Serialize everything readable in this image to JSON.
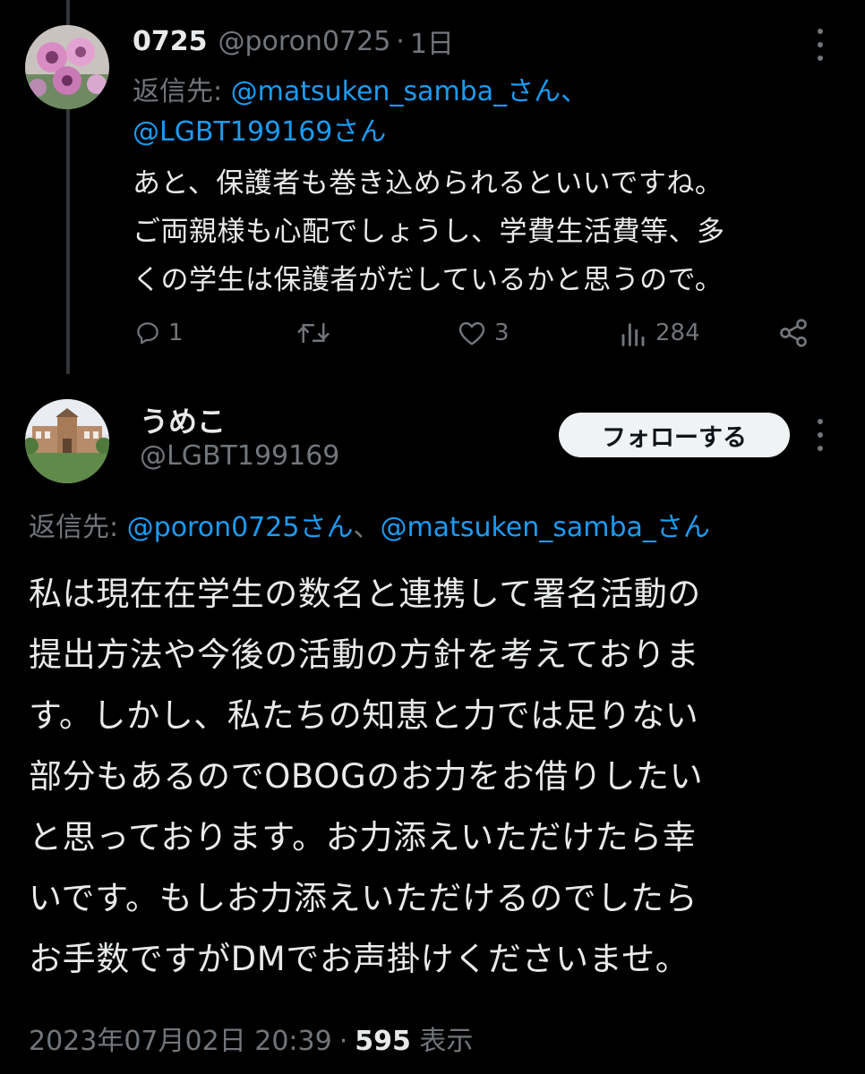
{
  "reply_tweet": {
    "display_name": "0725",
    "handle": "@poron0725",
    "separator": "·",
    "time": "1日",
    "reply_prefix": "返信先: ",
    "reply_mention_1": "@matsuken_samba_さん、",
    "reply_mention_2": "@LGBT199169さん",
    "body_lines": [
      "あと、保護者も巻き込められるといいですね。",
      "ご両親様も心配でしょうし、学費生活費等、多",
      "くの学生は保護者がだしているかと思うので。"
    ],
    "actions": {
      "reply_count": "1",
      "retweet_count": "",
      "like_count": "3",
      "view_count": "284"
    },
    "icons": {
      "reply": "reply-icon",
      "retweet": "retweet-icon",
      "like": "heart-icon",
      "views": "views-icon",
      "share": "share-icon",
      "more": "more-icon"
    }
  },
  "main_tweet": {
    "display_name": "うめこ",
    "handle": "@LGBT199169",
    "follow_label": "フォローする",
    "reply_prefix": "返信先: ",
    "reply_mention_1": "@poron0725さん",
    "reply_separator": "、",
    "reply_mention_2": "@matsuken_samba_さん",
    "body_lines": [
      "私は現在在学生の数名と連携して署名活動の",
      "提出方法や今後の活動の方針を考えておりま",
      "す。しかし、私たちの知恵と力では足りない",
      "部分もあるのでOBOGのお力をお借りしたい",
      "と思っております。お力添えいただけたら幸",
      "いです。もしお力添えいただけるのでしたら",
      "お手数ですがDMでお声掛けくださいませ。"
    ],
    "timestamp": "2023年07月02日 20:39",
    "separator": "·",
    "views_count": "595",
    "views_label": "表示"
  },
  "colors": {
    "background": "#000000",
    "text": "#e7e9ea",
    "secondary": "#71767b",
    "accent": "#1d9bf0",
    "follow_bg": "#eff3f4"
  }
}
